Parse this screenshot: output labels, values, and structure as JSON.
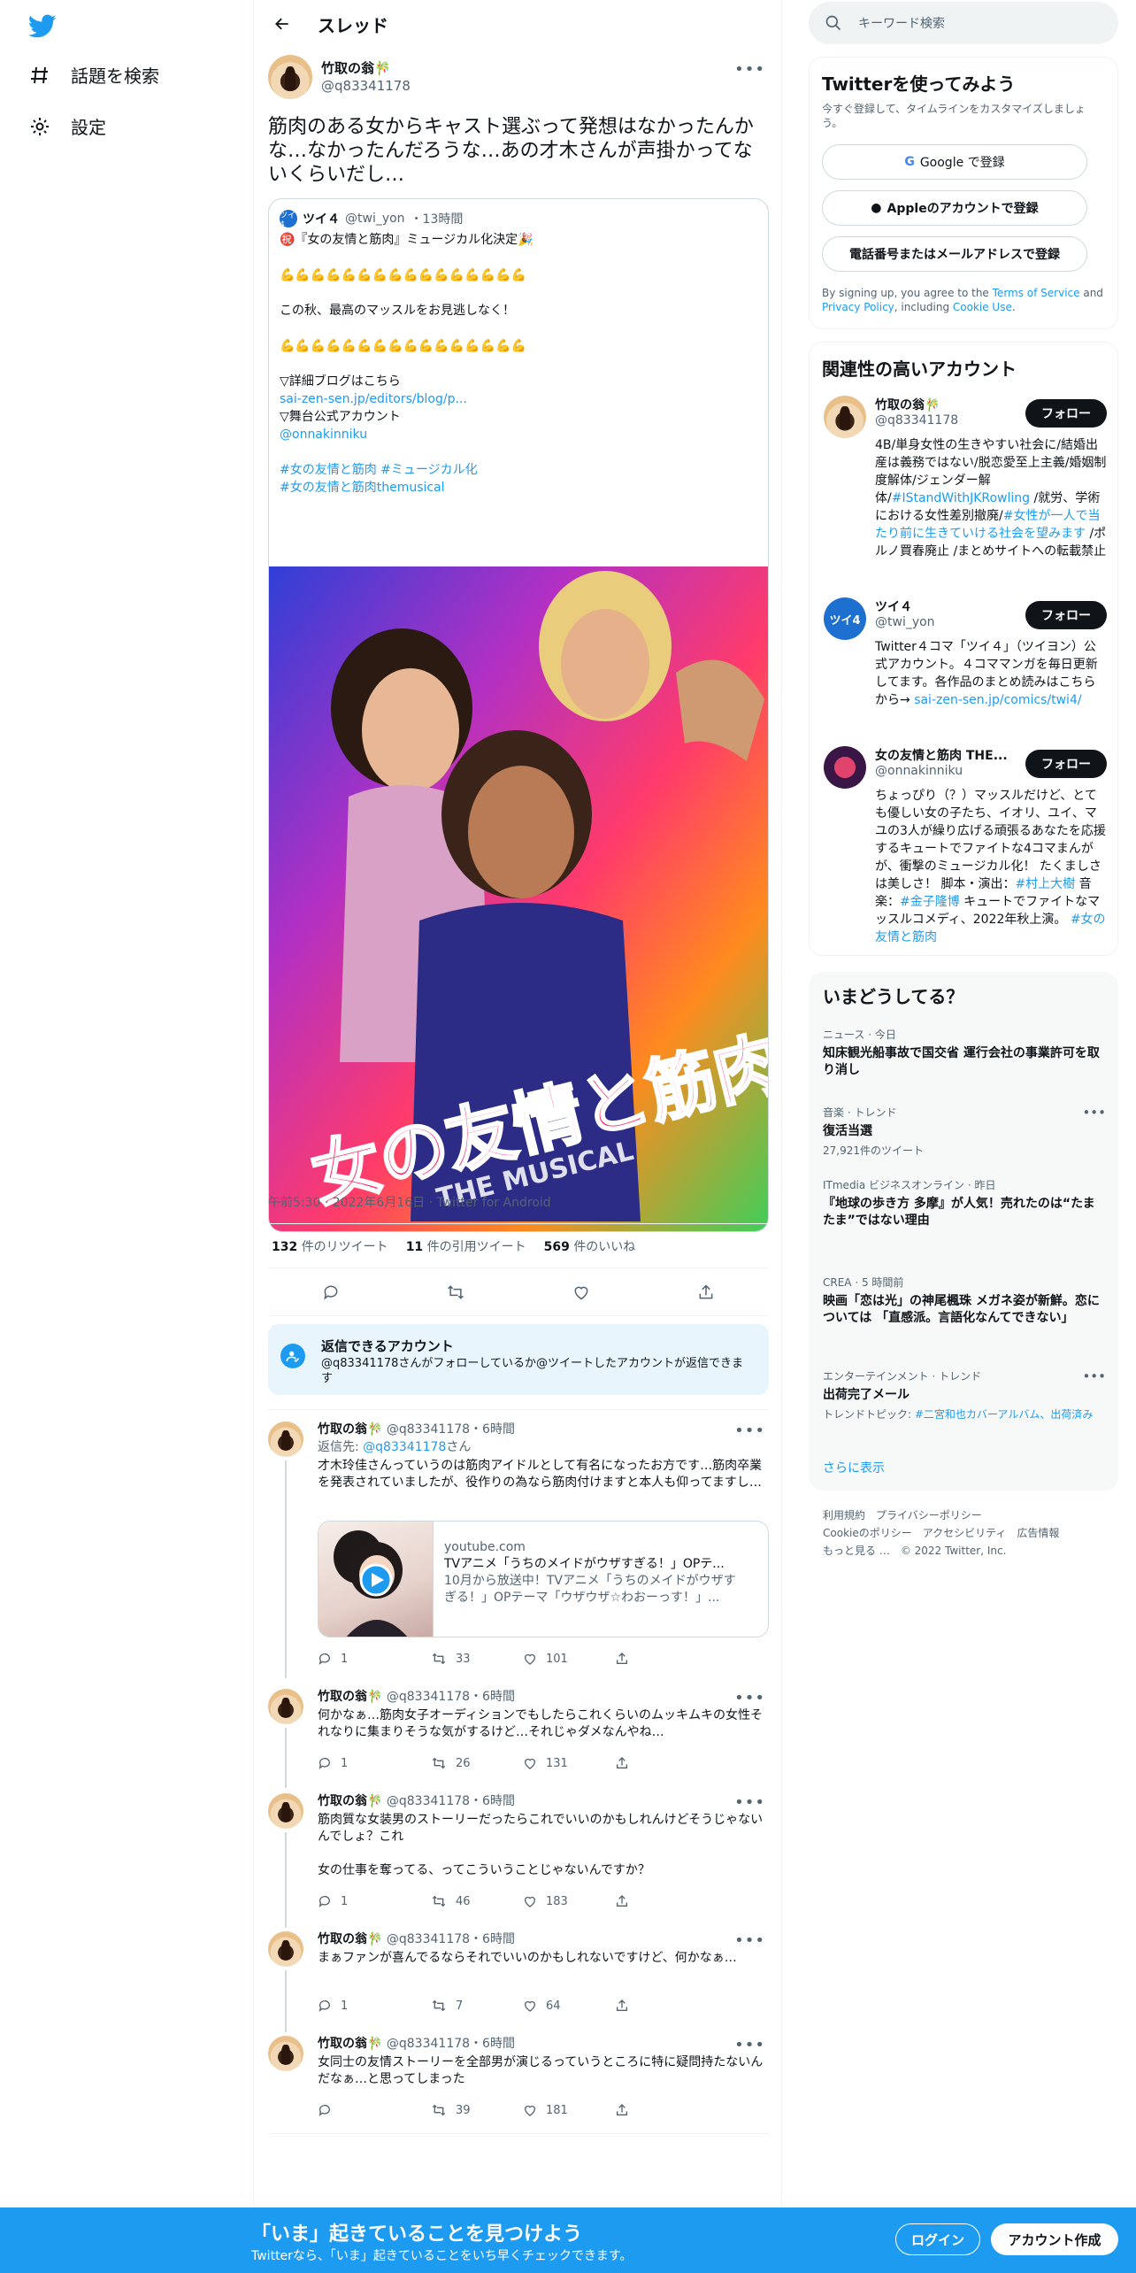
{
  "nav": {
    "explore": "話題を検索",
    "settings": "設定"
  },
  "header": {
    "title": "スレッド"
  },
  "main_tweet": {
    "name": "竹取の翁🎋",
    "handle": "@q83341178",
    "text": "筋肉のある女からキャスト選ぶって発想はなかったんかな…なかったんだろうな…あの才木さんが声掛かってないくらいだし…",
    "quote": {
      "name": "ツイ４",
      "handle": "@twi_yon",
      "time": "・13時間",
      "avatar_text": "ツイ4",
      "lines": [
        "㊗️『女の友情と筋肉』ミュージカル化決定🎉",
        "",
        "💪💪💪💪💪💪💪💪💪💪💪💪💪💪💪💪",
        "",
        "この秋、最高のマッスルをお見逃しなく！",
        "",
        "💪💪💪💪💪💪💪💪💪💪💪💪💪💪💪💪",
        "",
        "▽詳細ブログはこちら",
        "sai-zen-sen.jp/editors/blog/p...",
        "▽舞台公式アカウント",
        "@onnakinniku",
        "",
        "#女の友情と筋肉 #ミュージカル化",
        "#女の友情と筋肉themusical"
      ],
      "poster_title": "女の友情と筋肉",
      "poster_sub": "THE MUSICAL"
    },
    "timestamp": "午前5:30 · 2022年6月16日 · Twitter for Android",
    "retweets": "132",
    "retweets_label": "件のリツイート",
    "quotes": "11",
    "quotes_label": "件の引用ツイート",
    "likes": "569",
    "likes_label": "件のいいね"
  },
  "notice": {
    "title": "返信できるアカウント",
    "desc": "@q83341178さんがフォローしているか@ツイートしたアカウントが返信できます"
  },
  "replies": [
    {
      "name": "竹取の翁🎋",
      "handle": "@q83341178",
      "time": "・6時間",
      "reply_to_label": "返信先: ",
      "reply_to": "@q83341178",
      "reply_to_suffix": "さん",
      "text": "才木玲佳さんっていうのは筋肉アイドルとして有名になったお方です…筋肉卒業を発表されていましたが、役作りの為なら筋肉付けますと本人も仰ってますし…",
      "card": {
        "domain": "youtube.com",
        "title": "TVアニメ「うちのメイドがウザすぎる！」OPテ...",
        "desc1": "10月から放送中！TVアニメ「うちのメイドがウザす",
        "desc2": "ぎる！」OPテーマ「ウザウザ☆わおーっす！」..."
      },
      "replies": "1",
      "retweets": "33",
      "likes": "101"
    },
    {
      "name": "竹取の翁🎋",
      "handle": "@q83341178",
      "time": "・6時間",
      "text": "何かなぁ…筋肉女子オーディションでもしたらこれくらいのムッキムキの女性それなりに集まりそうな気がするけど…それじゃダメなんやね…",
      "replies": "1",
      "retweets": "26",
      "likes": "131"
    },
    {
      "name": "竹取の翁🎋",
      "handle": "@q83341178",
      "time": "・6時間",
      "text": "筋肉質な女装男のストーリーだったらこれでいいのかもしれんけどそうじゃないんでしょ？これ",
      "text2": "女の仕事を奪ってる、ってこういうことじゃないんですか？",
      "replies": "1",
      "retweets": "46",
      "likes": "183"
    },
    {
      "name": "竹取の翁🎋",
      "handle": "@q83341178",
      "time": "・6時間",
      "text": "まぁファンが喜んでるならそれでいいのかもしれないですけど、何かなぁ…",
      "replies": "1",
      "retweets": "7",
      "likes": "64"
    },
    {
      "name": "竹取の翁🎋",
      "handle": "@q83341178",
      "time": "・6時間",
      "text": "女同士の友情ストーリーを全部男が演じるっていうところに特に疑問持たないんだなぁ…と思ってしまった",
      "replies": "",
      "retweets": "39",
      "likes": "181"
    }
  ],
  "search": {
    "placeholder": "キーワード検索"
  },
  "signup_panel": {
    "title": "Twitterを使ってみよう",
    "desc": "今すぐ登録して、タイムラインをカスタマイズしましょう。",
    "google": "Google で登録",
    "apple": "Appleのアカウントで登録",
    "phone": "電話番号またはメールアドレスで登録",
    "terms_pre": "By signing up, you agree to the ",
    "terms_link": "Terms of Service",
    "terms_and": " and ",
    "privacy_link": "Privacy Policy",
    "terms_mid": ", including ",
    "cookie_link": "Cookie Use",
    "terms_end": "."
  },
  "related": {
    "title": "関連性の高いアカウント",
    "follow_label": "フォロー",
    "accounts": [
      {
        "name": "竹取の翁🎋",
        "handle": "@q83341178",
        "bio_a": "4B/単身女性の生きやすい社会に/結婚出産は義務ではない/脱恋愛至上主義/婚姻制度解体/ジェンダー解体/",
        "bio_link1": "#IStandWithJKRowling",
        "bio_b": " /就労、学術における女性差別撤廃/",
        "bio_link2": "#女性が一人で当たり前に生きていける社会を望みます",
        "bio_c": " /ポルノ買春廃止 /まとめサイトへの転載禁止"
      },
      {
        "name": "ツイ４",
        "handle": "@twi_yon",
        "avatar_text": "ツイ4",
        "bio_a": "Twitter４コマ「ツイ４」（ツイヨン）公式アカウント。４コママンガを毎日更新してます。各作品のまとめ読みはこちらから→ ",
        "bio_link1": "sai-zen-sen.jp/comics/twi4/"
      },
      {
        "name": "女の友情と筋肉 THE...",
        "handle": "@onnakinniku",
        "bio_a": "ちょっぴり（？）マッスルだけど、とても優しい女の子たち、イオリ、ユイ、マユの3人が繰り広げる頑張るあなたを応援するキュートでファイトな4コマまんがが、衝撃のミュージカル化！ たくましさは美しさ！ 脚本・演出：",
        "bio_link1": "#村上大樹",
        "bio_b": " 音楽：",
        "bio_link2": "#金子隆博",
        "bio_c": " キュートでファイトなマッスルコメディ、2022年秋上演。 ",
        "bio_link3": "#女の友情と筋肉"
      }
    ]
  },
  "trends": {
    "title": "いまどうしてる？",
    "items": [
      {
        "cat": "ニュース · 今日",
        "title": "知床観光船事故で国交省 運行会社の事業許可を取り消し"
      },
      {
        "cat": "音楽 · トレンド",
        "title": "復活当選",
        "sub": "27,921件のツイート"
      },
      {
        "cat": "ITmedia ビジネスオンライン · 昨日",
        "title": "『地球の歩き方 多摩』が人気！売れたのは“たまたま”ではない理由"
      },
      {
        "cat": "CREA · 5 時間前",
        "title": "映画「恋は光」の神尾楓珠 メガネ姿が新鮮。恋については 「直感派。言語化なんてできない」"
      },
      {
        "cat": "エンターテインメント · トレンド",
        "title": "出荷完了メール",
        "sub_label": "トレンドトピック: ",
        "sub_link": "#二宮和也カバーアルバム、出荷済み"
      }
    ],
    "show_more": "さらに表示"
  },
  "footer": {
    "l1": "利用規約",
    "l2": "プライバシーポリシー",
    "l3": "Cookieのポリシー",
    "l4": "アクセシビリティ",
    "l5": "広告情報",
    "l6": "もっと見る …",
    "l7": "© 2022 Twitter, Inc."
  },
  "banner": {
    "title": "「いま」起きていることを見つけよう",
    "sub": "Twitterなら、「いま」起きていることをいち早くチェックできます。",
    "login": "ログイン",
    "signup": "アカウント作成"
  }
}
